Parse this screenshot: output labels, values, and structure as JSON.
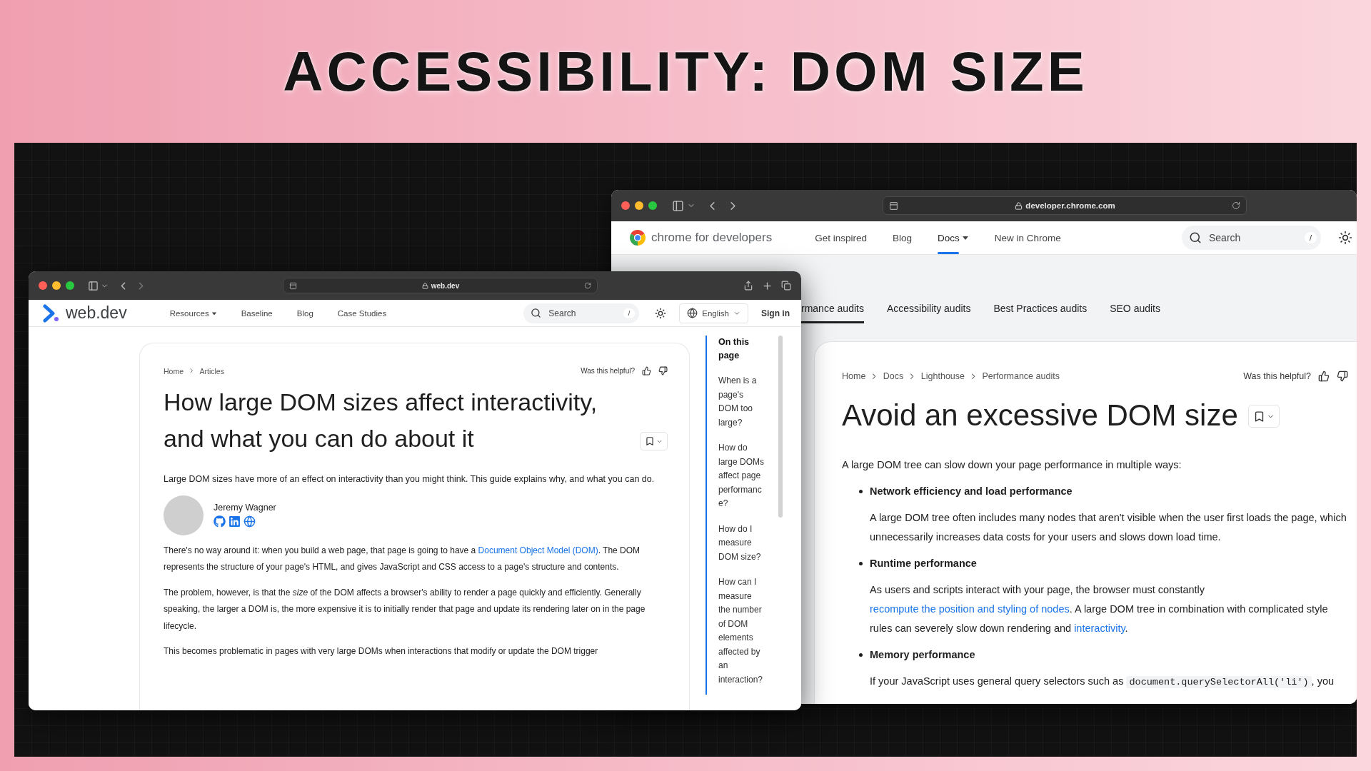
{
  "title": "ACCESSIBILITY: DOM SIZE",
  "back_window": {
    "url": "developer.chrome.com",
    "site_name": "chrome for developers",
    "nav": [
      {
        "label": "Get inspired",
        "dropdown": false,
        "selected": false
      },
      {
        "label": "Blog",
        "dropdown": false,
        "selected": false
      },
      {
        "label": "Docs",
        "dropdown": true,
        "selected": true
      },
      {
        "label": "New in Chrome",
        "dropdown": false,
        "selected": false
      }
    ],
    "search": {
      "placeholder": "Search",
      "shortcut": "/"
    },
    "tabs": [
      {
        "label": "rmance audits",
        "selected": true
      },
      {
        "label": "Accessibility audits",
        "selected": false
      },
      {
        "label": "Best Practices audits",
        "selected": false
      },
      {
        "label": "SEO audits",
        "selected": false
      }
    ],
    "breadcrumbs": [
      "Home",
      "Docs",
      "Lighthouse",
      "Performance audits"
    ],
    "feedback": "Was this helpful?",
    "heading": "Avoid an excessive DOM size",
    "intro": "A large DOM tree can slow down your page performance in multiple ways:",
    "sections": [
      {
        "heading": "Network efficiency and load performance",
        "body": [
          {
            "kind": "text",
            "text": "A large DOM tree often includes many nodes that aren't visible when the user first loads the page, which unnecessarily increases data costs for your users and slows down load time."
          }
        ]
      },
      {
        "heading": "Runtime performance",
        "body": [
          {
            "kind": "text",
            "text": "As users and scripts interact with your page, the browser must constantly "
          },
          {
            "kind": "link",
            "text": "recompute the position and styling of nodes"
          },
          {
            "kind": "text",
            "text": ". A large DOM tree in combination with complicated style rules can severely slow down rendering and "
          },
          {
            "kind": "link",
            "text": "interactivity"
          },
          {
            "kind": "text",
            "text": "."
          }
        ]
      },
      {
        "heading": "Memory performance",
        "body": [
          {
            "kind": "text",
            "text": "If your JavaScript uses general query selectors such as "
          },
          {
            "kind": "code",
            "text": "document.querySelectorAll('li')"
          },
          {
            "kind": "text",
            "text": ", you"
          }
        ]
      }
    ]
  },
  "front_window": {
    "url": "web.dev",
    "site_name": "web.dev",
    "nav": [
      {
        "label": "Resources",
        "dropdown": true
      },
      {
        "label": "Baseline",
        "dropdown": false
      },
      {
        "label": "Blog",
        "dropdown": false
      },
      {
        "label": "Case Studies",
        "dropdown": false
      }
    ],
    "search": {
      "placeholder": "Search",
      "shortcut": "/"
    },
    "language": "English",
    "sign_in": "Sign in",
    "breadcrumbs": [
      "Home",
      "Articles"
    ],
    "feedback": "Was this helpful?",
    "heading": "How large DOM sizes affect interactivity, and what you can do about it",
    "intro": "Large DOM sizes have more of an effect on interactivity than you might think. This guide explains why, and what you can do.",
    "author": {
      "name": "Jeremy Wagner"
    },
    "paragraphs": [
      [
        {
          "kind": "text",
          "text": "There's no way around it: when you build a web page, that page is going to have a "
        },
        {
          "kind": "link",
          "text": "Document Object Model (DOM)"
        },
        {
          "kind": "text",
          "text": ". The DOM represents the structure of your page's HTML, and gives JavaScript and CSS access to a page's structure and contents."
        }
      ],
      [
        {
          "kind": "text",
          "text": "The problem, however, is that the *size* of the DOM affects a browser's ability to render a page quickly and efficiently. Generally speaking, the larger a DOM is, the more expensive it is to initially render that page and update its rendering later on in the page lifecycle."
        }
      ],
      [
        {
          "kind": "text",
          "text": "This becomes problematic in pages with very large DOMs when interactions that modify or update the DOM trigger"
        }
      ]
    ],
    "toc": {
      "title": "On this page",
      "items": [
        "When is a page's DOM too large?",
        "How do large DOMs affect page performance?",
        "How do I measure DOM size?",
        "How can I measure the number of DOM elements affected by an interaction?"
      ]
    }
  }
}
